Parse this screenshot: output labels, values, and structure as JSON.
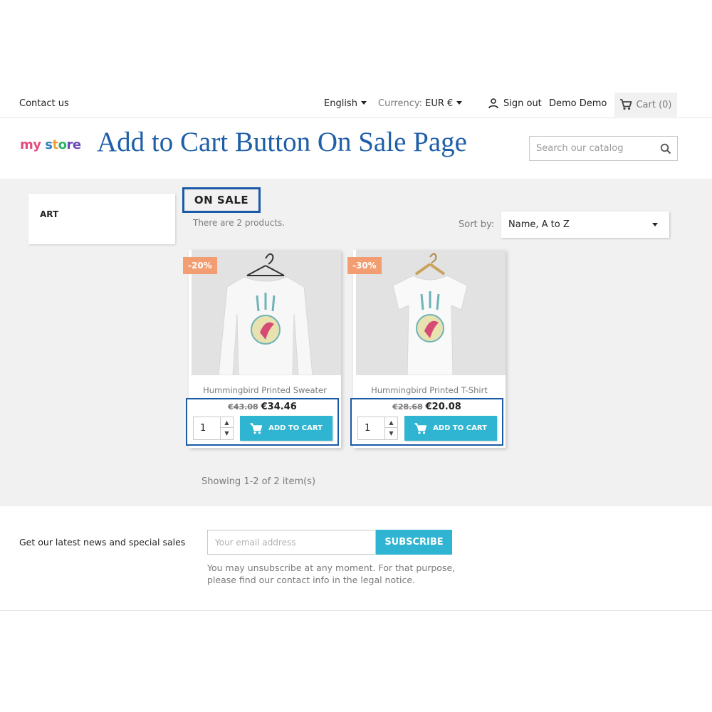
{
  "topnav": {
    "contact": "Contact us",
    "language": "English",
    "currency_label": "Currency:",
    "currency_value": "EUR €",
    "sign_out": "Sign out",
    "username": "Demo Demo",
    "cart": "Cart (0)"
  },
  "header": {
    "logo": {
      "part1": "my",
      "part2": "s",
      "part3": "t",
      "part4": "o",
      "part5": "re"
    },
    "banner_title": "Add to Cart Button On Sale Page",
    "search_placeholder": "Search our catalog"
  },
  "sidebar": {
    "category": "ART"
  },
  "listing": {
    "title": "ON SALE",
    "count_text": "There are 2 products.",
    "sort_label": "Sort by:",
    "sort_value": "Name, A to Z",
    "showing": "Showing 1-2 of 2 item(s)"
  },
  "products": [
    {
      "name": "Hummingbird Printed Sweater",
      "discount": "-20%",
      "old_price": "€43.08",
      "price": "€34.46",
      "qty": "1",
      "add_label": "ADD TO CART"
    },
    {
      "name": "Hummingbird Printed T-Shirt",
      "discount": "-30%",
      "old_price": "€28.68",
      "price": "€20.08",
      "qty": "1",
      "add_label": "ADD TO CART"
    }
  ],
  "newsletter": {
    "text": "Get our latest news and special sales",
    "email_placeholder": "Your email address",
    "subscribe": "SUBSCRIBE",
    "legal_line1": "You may unsubscribe at any moment. For that purpose,",
    "legal_line2": "please find our contact info in the legal notice."
  },
  "colors": {
    "accent": "#2fb5d2",
    "highlight_border": "#1b5aa6",
    "discount_badge": "#f39d72",
    "banner_text": "#1f5fa8"
  }
}
